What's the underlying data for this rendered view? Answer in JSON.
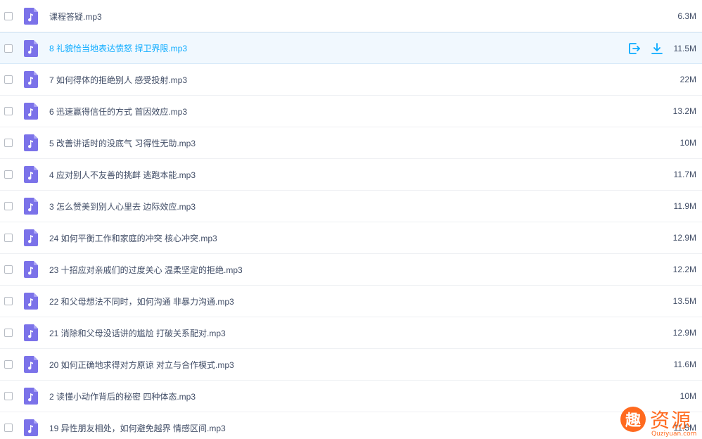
{
  "files": [
    {
      "name": "课程答疑.mp3",
      "size": "6.3M"
    },
    {
      "name": "8 礼貌恰当地表达愤怒 捍卫界限.mp3",
      "size": "11.5M",
      "hover": true
    },
    {
      "name": "7 如何得体的拒绝别人 感受投射.mp3",
      "size": "22M"
    },
    {
      "name": "6 迅速赢得信任的方式 首因效应.mp3",
      "size": "13.2M"
    },
    {
      "name": "5 改善讲话时的没底气 习得性无助.mp3",
      "size": "10M"
    },
    {
      "name": "4 应对别人不友善的挑衅 逃跑本能.mp3",
      "size": "11.7M"
    },
    {
      "name": "3 怎么赞美到别人心里去 边际效应.mp3",
      "size": "11.9M"
    },
    {
      "name": "24 如何平衡工作和家庭的冲突 核心冲突.mp3",
      "size": "12.9M"
    },
    {
      "name": "23 十招应对亲戚们的过度关心 温柔坚定的拒绝.mp3",
      "size": "12.2M"
    },
    {
      "name": "22 和父母想法不同时，如何沟通 非暴力沟通.mp3",
      "size": "13.5M"
    },
    {
      "name": "21 消除和父母没话讲的尴尬 打破关系配对.mp3",
      "size": "12.9M"
    },
    {
      "name": "20 如何正确地求得对方原谅 对立与合作模式.mp3",
      "size": "11.6M"
    },
    {
      "name": "2 读懂小动作背后的秘密 四种体态.mp3",
      "size": "10M"
    },
    {
      "name": "19 异性朋友相处，如何避免越界 情感区间.mp3",
      "size": "11.5M"
    }
  ],
  "icons": {
    "file": "audio-file-icon",
    "share": "share-icon",
    "download": "download-icon"
  },
  "colors": {
    "icon_bg": "#7b72e9",
    "accent": "#09aaff",
    "text": "#424e67",
    "hover_bg": "#f1f8fe"
  },
  "watermark": {
    "glyph": "趣",
    "text": "资源",
    "sub": "Quziyuan.com"
  }
}
